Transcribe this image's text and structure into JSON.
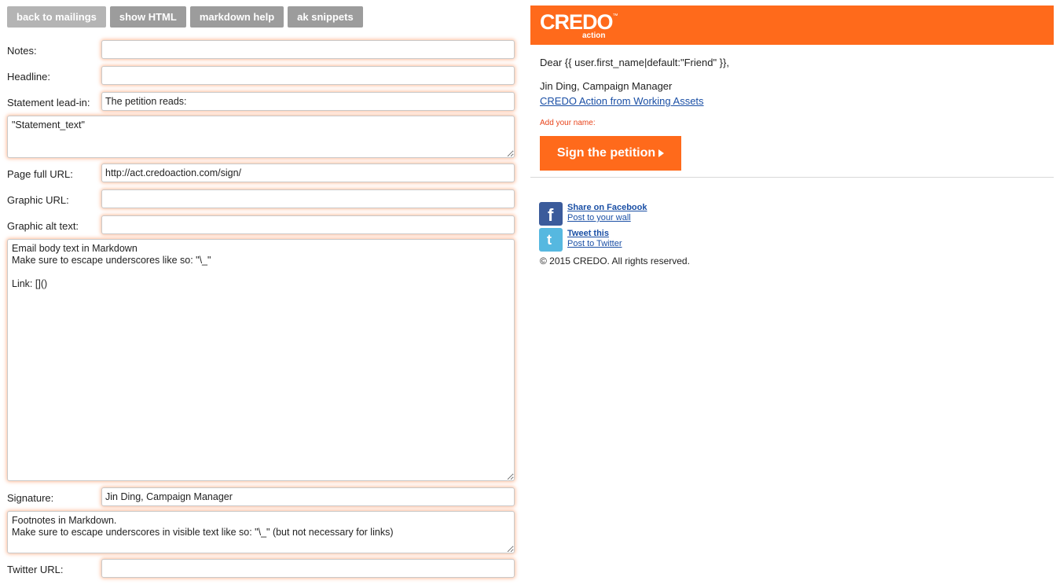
{
  "toolbar": {
    "back_label": "back to mailings",
    "show_html_label": "show HTML",
    "markdown_help_label": "markdown help",
    "ak_snippets_label": "ak snippets"
  },
  "form": {
    "notes_label": "Notes:",
    "notes_value": "",
    "headline_label": "Headline:",
    "headline_value": "",
    "statement_leadin_label": "Statement lead-in:",
    "statement_leadin_value": "The petition reads:",
    "statement_text_value": "\"Statement_text\"",
    "page_url_label": "Page full URL:",
    "page_url_value": "http://act.credoaction.com/sign/",
    "graphic_url_label": "Graphic URL:",
    "graphic_url_value": "",
    "graphic_alt_label": "Graphic alt text:",
    "graphic_alt_value": "",
    "body_value": "Email body text in Markdown\nMake sure to escape underscores like so: \"\\_\"\n\nLink: []()",
    "signature_label": "Signature:",
    "signature_value": "Jin Ding, Campaign Manager",
    "footnotes_value": "Footnotes in Markdown.\nMake sure to escape underscores in visible text like so: \"\\_\" (but not necessary for links)",
    "twitter_url_label": "Twitter URL:",
    "twitter_url_value": ""
  },
  "preview": {
    "logo_text": "CREDO",
    "logo_tm": "™",
    "logo_sub": "action",
    "greeting": "Dear {{ user.first_name|default:\"Friend\" }},",
    "signature": "Jin Ding, Campaign Manager",
    "org_link": "CREDO Action from Working Assets",
    "add_name": "Add your name:",
    "sign_button": "Sign the petition",
    "facebook_title": "Share on Facebook",
    "facebook_sub": "Post to your wall",
    "twitter_title": "Tweet this",
    "twitter_sub": "Post to Twitter",
    "copyright": "© 2015 CREDO. All rights reserved."
  },
  "colors": {
    "brand_orange": "#ff6a1b",
    "toolbar_gray": "#9c9c9c",
    "link_blue": "#1a4fa5",
    "facebook_blue": "#3b5b9b",
    "twitter_blue": "#56b8e0"
  },
  "icons": {
    "facebook": "facebook-icon",
    "twitter": "twitter-icon",
    "sign_arrow": "play-arrow-icon"
  }
}
